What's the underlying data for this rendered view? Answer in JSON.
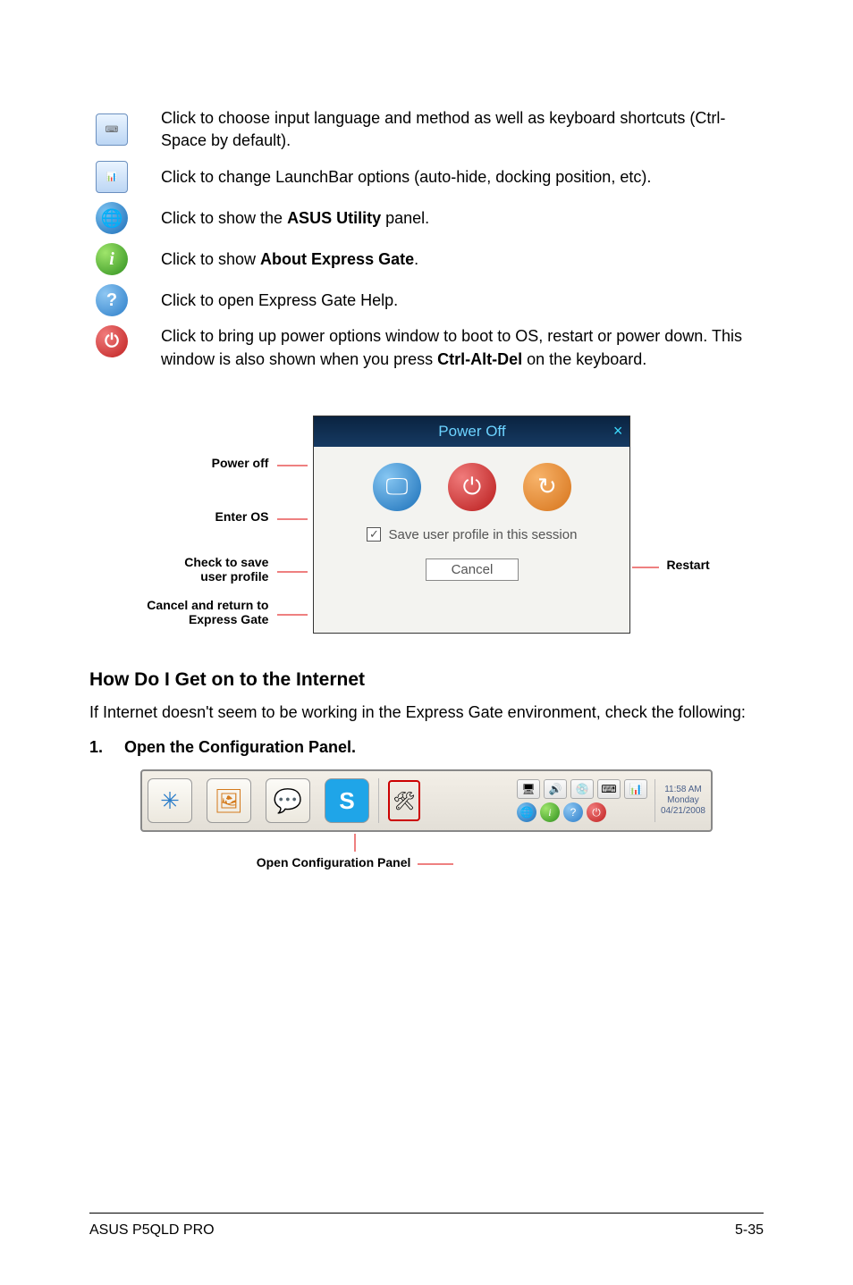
{
  "icon_list": [
    {
      "type": "tile",
      "text": "Click to choose input language and method as well as keyboard shortcuts (Ctrl-Space by default)."
    },
    {
      "type": "tile",
      "text": "Click to change LaunchBar options (auto-hide, docking position, etc)."
    },
    {
      "type": "globe",
      "text": "Click to show the ",
      "bold": "ASUS Utility",
      "suffix": " panel."
    },
    {
      "type": "info",
      "text": "Click to show ",
      "bold": "About Express Gate",
      "suffix": "."
    },
    {
      "type": "help",
      "text": "Click to open Express Gate Help."
    },
    {
      "type": "power",
      "text": "Click to bring up power options window to boot to OS, restart or power down. This window is also shown when you press ",
      "bold": "Ctrl-Alt-Del",
      "suffix": " on the keyboard."
    }
  ],
  "dialog": {
    "title": "Power Off",
    "save_label": "Save user profile in this session",
    "cancel_label": "Cancel"
  },
  "dialog_labels": {
    "power_off": "Power off",
    "enter_os": "Enter OS",
    "check_save_l1": "Check to save",
    "check_save_l2": "user profile",
    "cancel_l1": "Cancel and return to",
    "cancel_l2": "Express Gate",
    "restart": "Restart"
  },
  "section": {
    "heading": "How Do I Get on to the Internet",
    "para": "If Internet doesn't seem to be working in the Express Gate  environment, check the following:",
    "step1_num": "1.",
    "step1_text": "Open the Configuration Panel."
  },
  "launchbar": {
    "time": "11:58 AM",
    "day": "Monday",
    "date": "04/21/2008",
    "callout": "Open Configuration Panel"
  },
  "footer": {
    "left": "ASUS P5QLD PRO",
    "right": "5-35"
  }
}
